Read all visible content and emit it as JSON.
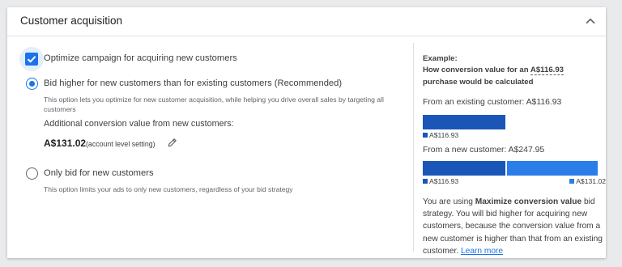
{
  "section": {
    "title": "Customer acquisition"
  },
  "options": {
    "optimize_checkbox": {
      "label": "Optimize campaign for acquiring new customers",
      "checked": true
    },
    "bid_higher": {
      "label": "Bid higher for new customers than for existing customers (Recommended)",
      "description": "This option lets you optimize for new customer acquisition, while helping you drive overall sales by targeting all customers",
      "selected": true,
      "sub_label": "Additional conversion value from new customers:",
      "value": "A$131.02",
      "value_note": "(account level setting)"
    },
    "only_new": {
      "label": "Only bid for new customers",
      "description": "This option limits your ads to only new customers, regardless of your bid strategy",
      "selected": false
    }
  },
  "example": {
    "title": "Example:",
    "line1_prefix": "How conversion value for an ",
    "line1_amount": "A$116.93",
    "line2": "purchase would be calculated",
    "existing_label": "From an existing customer: A$116.93",
    "existing_legend": "A$116.93",
    "new_label": "From a new customer: A$247.95",
    "new_legend_base": "A$116.93",
    "new_legend_extra": "A$131.02",
    "summary_prefix": "You are using ",
    "summary_strategy": "Maximize conversion value",
    "summary_suffix": " bid strategy. You will bid higher for acquiring new customers, because the conversion value from a new customer is higher than that from an existing customer. ",
    "learn_more": "Learn more"
  },
  "chart_data": {
    "type": "bar",
    "orientation": "horizontal-stacked",
    "categories": [
      "From an existing customer",
      "From a new customer"
    ],
    "series": [
      {
        "name": "A$116.93",
        "values": [
          116.93,
          116.93
        ]
      },
      {
        "name": "A$131.02",
        "values": [
          0,
          131.02
        ]
      }
    ],
    "colors": [
      "#1a56b8",
      "#2b7de9"
    ],
    "xlim": [
      0,
      247.95
    ]
  },
  "colors": {
    "accent": "#1a73e8",
    "bar_dark": "#1a56b8",
    "bar_light": "#2b7de9"
  }
}
